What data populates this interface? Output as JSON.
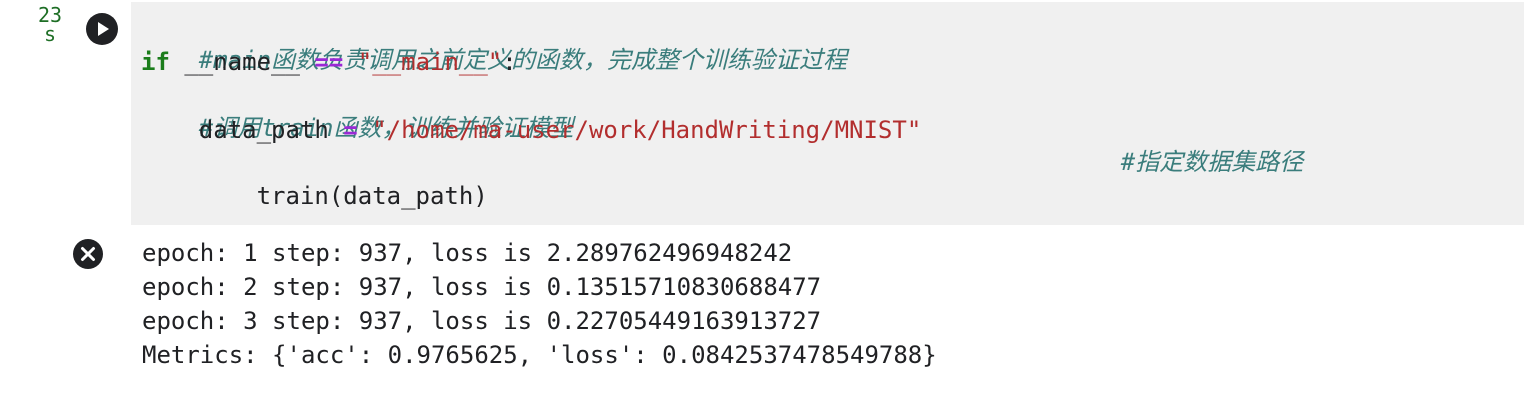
{
  "cell": {
    "exec_time_value": "23",
    "exec_time_unit": "s",
    "code": {
      "line1_comment": "#main函数负责调用之前定义的函数，完成整个训练验证过程",
      "line2_kw": "if",
      "line2_name": " __name__ ",
      "line2_op": "==",
      "line2_str": "\"__main__\"",
      "line2_colon": ":",
      "line3_comment": "#调用train函数，训练并验证模型",
      "line4_var": "    data_path ",
      "line4_op": "=",
      "line4_str": "\"/home/ma-user/work/HandWriting/MNIST\"",
      "line4_comment": "#指定数据集路径",
      "line5": "    train(data_path)"
    },
    "output": [
      "epoch: 1 step: 937, loss is 2.289762496948242",
      "epoch: 2 step: 937, loss is 0.13515710830688477",
      "epoch: 3 step: 937, loss is 0.22705449163913727",
      "Metrics: {'acc': 0.9765625, 'loss': 0.0842537478549788}"
    ]
  },
  "icons": {
    "run": "play-circle-icon",
    "clear_output": "close-circle-icon"
  }
}
